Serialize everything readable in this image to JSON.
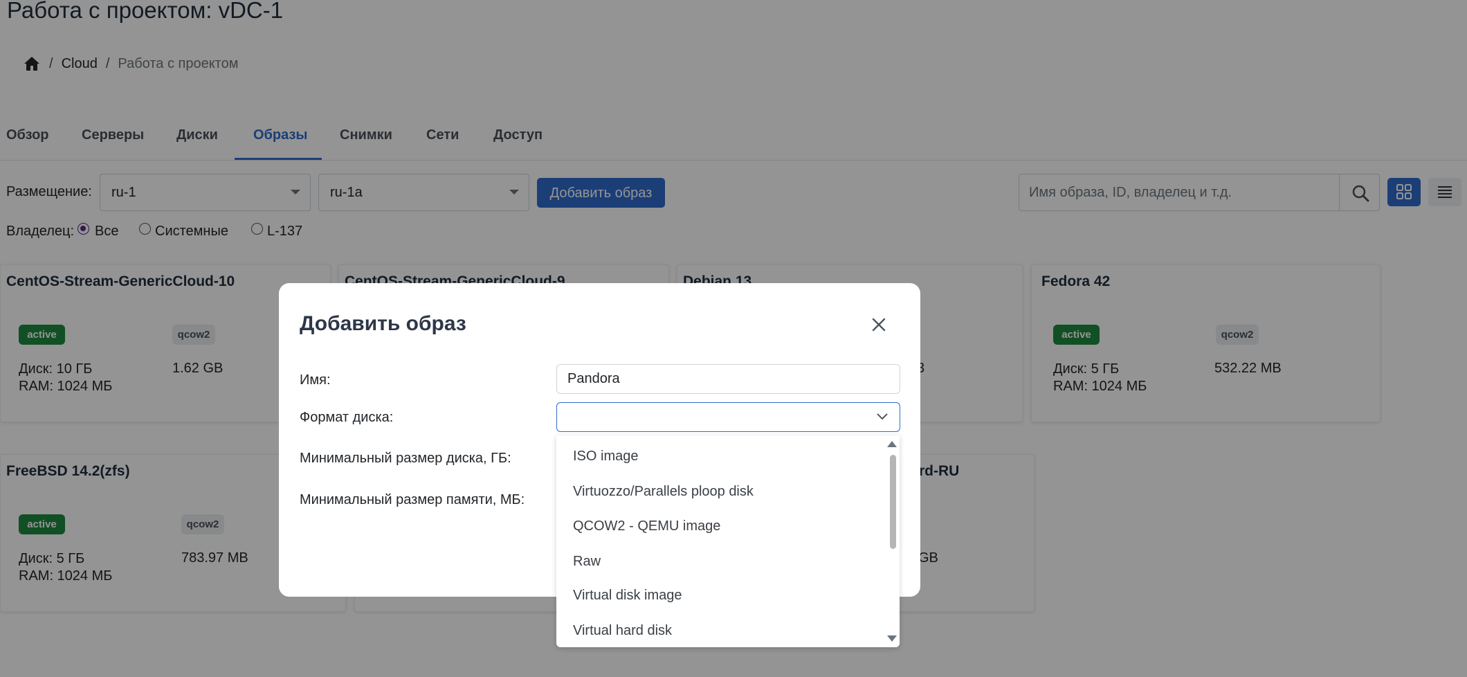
{
  "page": {
    "title": "Работа с проектом: vDC-1"
  },
  "breadcrumb": {
    "home_icon": "home-icon",
    "sep": "/",
    "items": [
      "Cloud",
      "Работа с проектом"
    ]
  },
  "tabs": [
    "Обзор",
    "Серверы",
    "Диски",
    "Образы",
    "Снимки",
    "Сети",
    "Доступ"
  ],
  "active_tab": "Образы",
  "toolbar": {
    "placement_label": "Размещение:",
    "region": "ru-1",
    "zone": "ru-1a",
    "add_image_label": "Добавить образ",
    "search_placeholder": "Имя образа, ID, владелец и т.д.",
    "search_icon": "search-icon",
    "grid_view_icon": "grid-icon",
    "list_view_icon": "list-icon"
  },
  "owner_filter": {
    "label": "Владелец:",
    "options": [
      "Все",
      "Системные",
      "L-137"
    ],
    "selected": "Все"
  },
  "cards": [
    {
      "title": "CentOS-Stream-GenericCloud-10",
      "status": "active",
      "format": "qcow2",
      "disk": "Диск: 10 ГБ",
      "ram": "RAM: 1024 МБ",
      "size": "1.62 GB"
    },
    {
      "title": "CentOS-Stream-GenericCloud-9"
    },
    {
      "title": "Debian 13",
      "size_fragment": "3"
    },
    {
      "title": "Fedora 42",
      "status": "active",
      "format": "qcow2",
      "disk": "Диск: 5 ГБ",
      "ram": "RAM: 1024 МБ",
      "size": "532.22 MB"
    },
    {
      "title": "FreeBSD 14.2(zfs)",
      "status": "active",
      "format": "qcow2",
      "disk": "Диск: 5 ГБ",
      "ram": "RAM: 1024 МБ",
      "size": "783.97 MB"
    },
    {
      "title_fragment": "rd-RU",
      "size_fragment": "GB"
    }
  ],
  "modal": {
    "title": "Добавить образ",
    "close_icon": "close-icon",
    "fields": {
      "name_label": "Имя:",
      "name_value": "Pandora",
      "format_label": "Формат диска:",
      "format_value": "",
      "min_disk_label": "Минимальный размер диска, ГБ:",
      "min_ram_label": "Минимальный размер памяти, МБ:"
    },
    "format_options": [
      "ISO image",
      "Virtuozzo/Parallels ploop disk",
      "QCOW2 - QEMU image",
      "Raw",
      "Virtual disk image",
      "Virtual hard disk"
    ]
  },
  "colors": {
    "accent": "#2f6bce",
    "active_badge": "#1e8a3e",
    "radio_checked": "#5b2a86"
  }
}
